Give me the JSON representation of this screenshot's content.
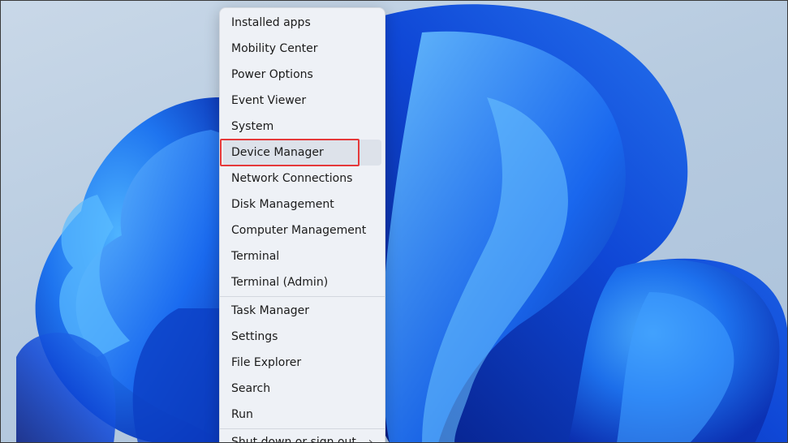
{
  "menu": {
    "items": [
      {
        "label": "Installed apps"
      },
      {
        "label": "Mobility Center"
      },
      {
        "label": "Power Options"
      },
      {
        "label": "Event Viewer"
      },
      {
        "label": "System"
      },
      {
        "label": "Device Manager",
        "hovered": true,
        "highlighted": true
      },
      {
        "label": "Network Connections"
      },
      {
        "label": "Disk Management"
      },
      {
        "label": "Computer Management"
      },
      {
        "label": "Terminal"
      },
      {
        "label": "Terminal (Admin)"
      }
    ],
    "items_group2": [
      {
        "label": "Task Manager"
      },
      {
        "label": "Settings"
      },
      {
        "label": "File Explorer"
      },
      {
        "label": "Search"
      },
      {
        "label": "Run"
      },
      {
        "label": "Shut down or sign out",
        "has_submenu": true
      }
    ]
  },
  "colors": {
    "highlight_border": "#e5393a",
    "menu_background": "#eef1f6",
    "wallpaper_blue": "#1f5fe0"
  },
  "icons": {
    "submenu": "chevron-right-icon"
  }
}
